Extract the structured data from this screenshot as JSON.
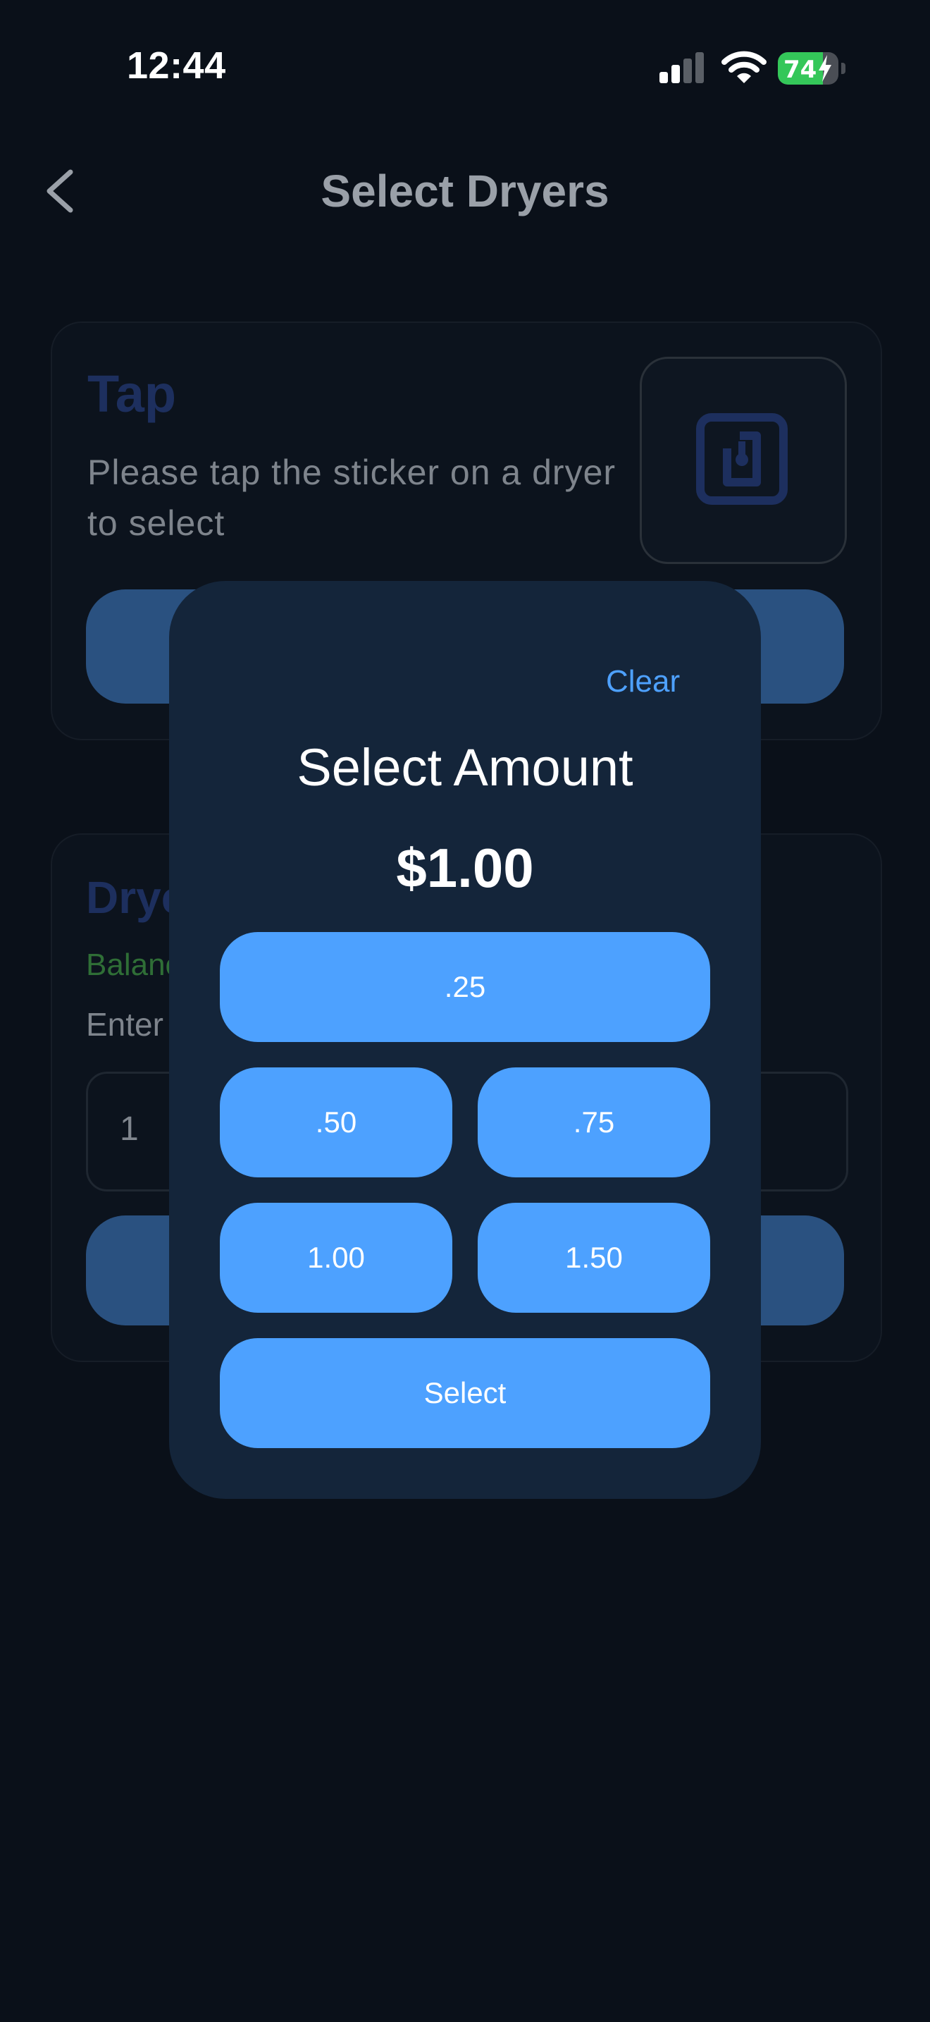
{
  "status_bar": {
    "time": "12:44",
    "battery_percent": "74",
    "battery_level": 0.74
  },
  "header": {
    "title": "Select Dryers",
    "back_icon": "chevron-left-icon"
  },
  "tap_card": {
    "heading": "Tap",
    "description": "Please tap the sticker on a dryer to select",
    "icon": "nfc-icon"
  },
  "dryer_card": {
    "heading_partial": "Drye",
    "balance_partial": "Balanc",
    "enter_partial": "Enter",
    "input_value": "1"
  },
  "modal": {
    "clear_label": "Clear",
    "title": "Select Amount",
    "amount": "$1.00",
    "options": {
      "o025": ".25",
      "o050": ".50",
      "o075": ".75",
      "o100": "1.00",
      "o150": "1.50"
    },
    "select_label": "Select"
  },
  "colors": {
    "background": "#0a1019",
    "modal": "#14253a",
    "accent": "#4da1ff",
    "balance_green": "#2f6e36"
  }
}
